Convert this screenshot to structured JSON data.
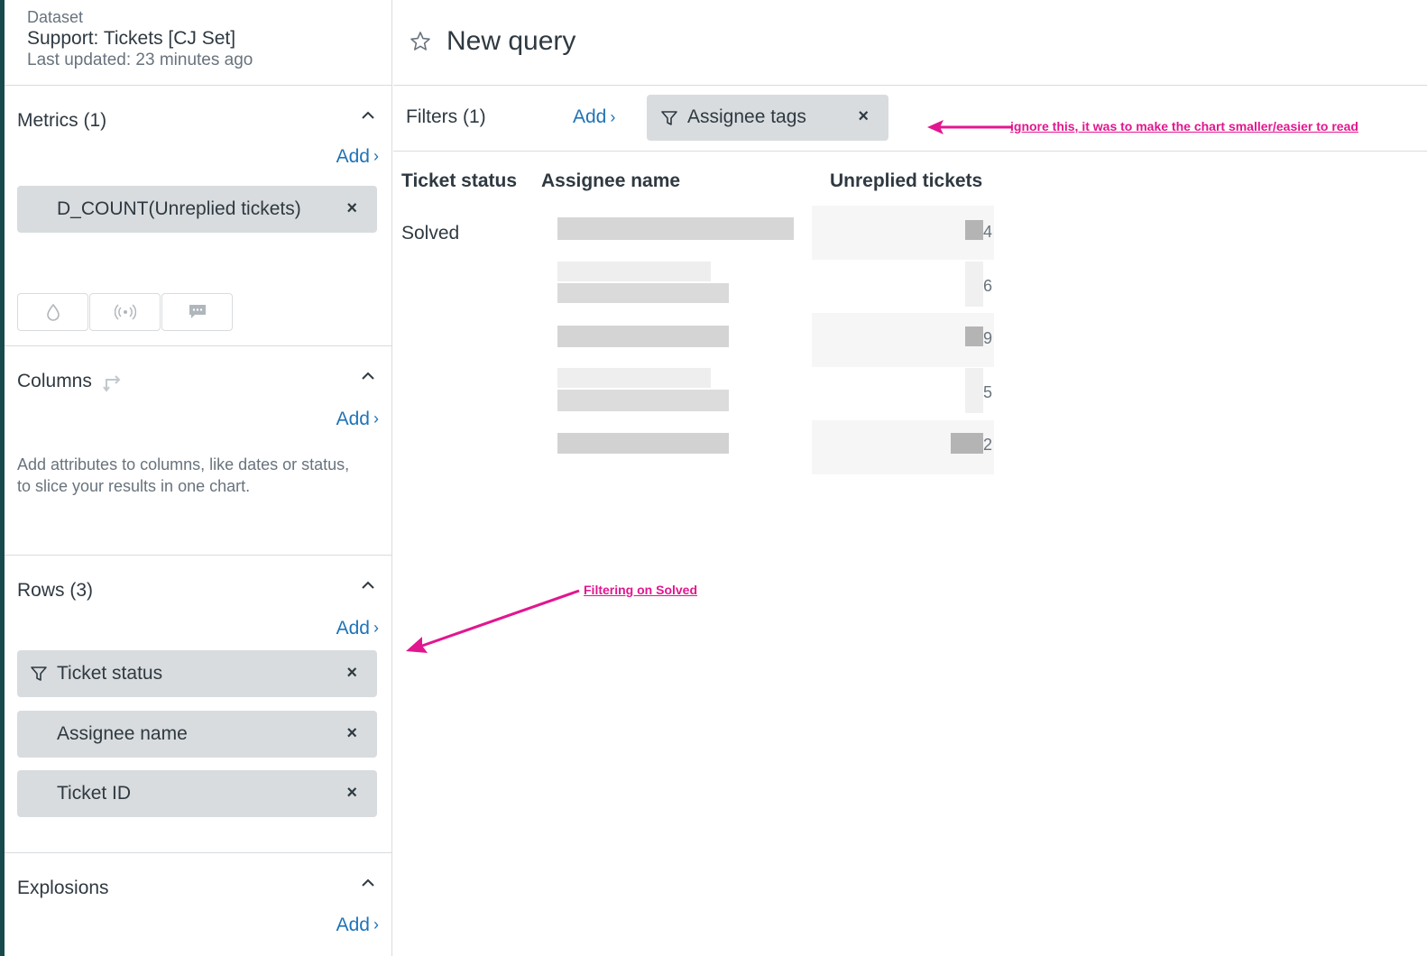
{
  "dataset": {
    "label": "Dataset",
    "name": "Support: Tickets [CJ Set]",
    "updated": "Last updated: 23 minutes ago"
  },
  "metrics": {
    "title": "Metrics (1)",
    "add_label": "Add",
    "items": [
      "D_COUNT(Unreplied tickets)"
    ],
    "viz_icons": [
      "droplet-icon",
      "broadcast-icon",
      "chat-icon"
    ]
  },
  "columns": {
    "title": "Columns",
    "add_label": "Add",
    "helper": "Add attributes to columns, like dates or status, to slice your results in one chart."
  },
  "rows": {
    "title": "Rows (3)",
    "add_label": "Add",
    "items": [
      "Ticket status",
      "Assignee name",
      "Ticket ID"
    ]
  },
  "explosions": {
    "title": "Explosions",
    "add_label": "Add"
  },
  "query": {
    "title": "New query"
  },
  "filters": {
    "label": "Filters (1)",
    "add_label": "Add",
    "chips": [
      "Assignee tags"
    ]
  },
  "table": {
    "headers": [
      "Ticket status",
      "Assignee name",
      "Unreplied tickets"
    ],
    "status_value": "Solved",
    "value_fragments": [
      "4",
      "6",
      "9",
      "5",
      "2"
    ]
  },
  "annotations": {
    "top": "ignore this, it was to make the chart smaller/easier to read",
    "middle": "Filtering on Solved"
  },
  "colors": {
    "accent": "#1f73b7",
    "annotation": "#e2168f",
    "pill": "#d8dcde",
    "edge": "#17494d"
  }
}
